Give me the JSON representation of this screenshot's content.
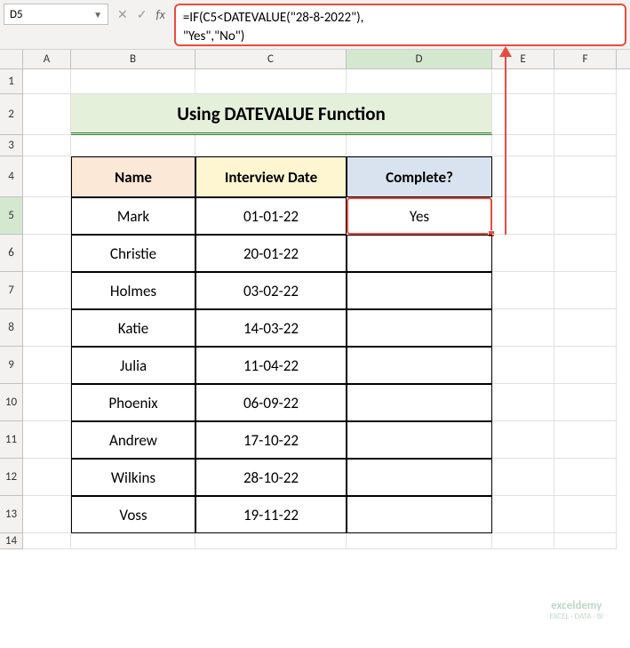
{
  "nameBox": "D5",
  "formula": "=IF(C5<DATEVALUE(\"28-8-2022\"),\n\"Yes\",\"No\")",
  "cols": {
    "A": "A",
    "B": "B",
    "C": "C",
    "D": "D",
    "E": "E",
    "F": "F"
  },
  "rowLabels": [
    "1",
    "2",
    "3",
    "4",
    "5",
    "6",
    "7",
    "8",
    "9",
    "10",
    "11",
    "12",
    "13",
    "14"
  ],
  "title": "Using DATEVALUE Function",
  "headers": {
    "name": "Name",
    "date": "Interview Date",
    "complete": "Complete?"
  },
  "data": [
    {
      "name": "Mark",
      "date": "01-01-22",
      "complete": "Yes"
    },
    {
      "name": "Christie",
      "date": "20-01-22",
      "complete": ""
    },
    {
      "name": "Holmes",
      "date": "03-02-22",
      "complete": ""
    },
    {
      "name": "Katie",
      "date": "14-03-22",
      "complete": ""
    },
    {
      "name": "Julia",
      "date": "11-04-22",
      "complete": ""
    },
    {
      "name": "Phoenix",
      "date": "06-09-22",
      "complete": ""
    },
    {
      "name": "Andrew",
      "date": "17-10-22",
      "complete": ""
    },
    {
      "name": "Wilkins",
      "date": "28-10-22",
      "complete": ""
    },
    {
      "name": "Voss",
      "date": "19-11-22",
      "complete": ""
    }
  ],
  "watermark": {
    "main": "exceldemy",
    "sub": "EXCEL · DATA · BI"
  },
  "fx": {
    "cancel": "✕",
    "accept": "✓",
    "label": "fx"
  }
}
